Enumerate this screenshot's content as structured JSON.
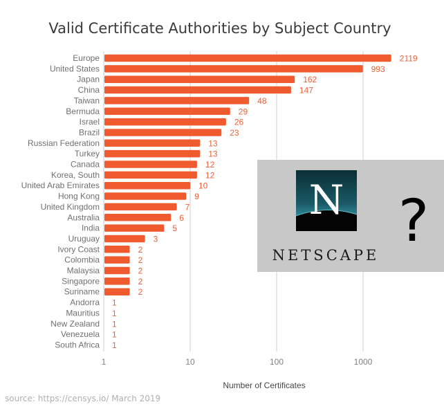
{
  "chart_data": {
    "type": "bar",
    "orientation": "horizontal",
    "title": "Valid Certificate Authorities by Subject Country",
    "xlabel": "Number of Certificates",
    "ylabel": "",
    "xscale": "log",
    "xlim": [
      1,
      4000
    ],
    "xticks": [
      1,
      10,
      100,
      1000
    ],
    "xtick_labels": [
      "1",
      "10",
      "100",
      "1000"
    ],
    "grid": "vertical",
    "bar_color": "#f05a2f",
    "label_color": "#e8613a",
    "categories": [
      "Europe",
      "United States",
      "Japan",
      "China",
      "Taiwan",
      "Bermuda",
      "Israel",
      "Brazil",
      "Russian Federation",
      "Turkey",
      "Canada",
      "Korea, South",
      "United Arab Emirates",
      "Hong Kong",
      "United Kingdom",
      "Australia",
      "India",
      "Uruguay",
      "Ivory Coast",
      "Colombia",
      "Malaysia",
      "Singapore",
      "Suriname",
      "Andorra",
      "Mauritius",
      "New Zealand",
      "Venezuela",
      "South Africa"
    ],
    "values": [
      2119,
      993,
      162,
      147,
      48,
      29,
      26,
      23,
      13,
      13,
      12,
      12,
      10,
      9,
      7,
      6,
      5,
      3,
      2,
      2,
      2,
      2,
      2,
      1,
      1,
      1,
      1,
      1
    ],
    "annotation_image": {
      "logo_letter": "N",
      "logo_wordmark": "NETSCAPE",
      "symbol": "?"
    }
  },
  "source_note": "source: https://censys.io/ March 2019"
}
